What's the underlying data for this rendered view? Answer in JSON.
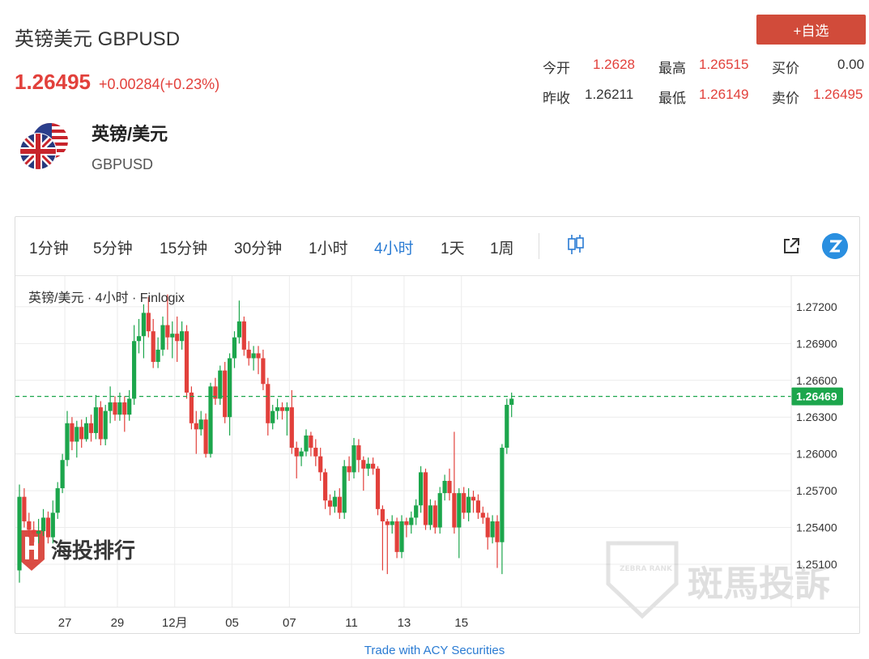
{
  "header": {
    "title": "英镑美元 GBPUSD",
    "price": "1.26495",
    "change": "+0.00284(+0.23%)",
    "add_button": "+自选"
  },
  "quotes": [
    {
      "label": "今开",
      "value": "1.2628"
    },
    {
      "label": "最高",
      "value": "1.26515"
    },
    {
      "label": "买价",
      "value": "0.00"
    },
    {
      "label": "昨收",
      "value": "1.26211"
    },
    {
      "label": "最低",
      "value": "1.26149"
    },
    {
      "label": "卖价",
      "value": "1.26495"
    }
  ],
  "instrument": {
    "name_cn": "英镑/美元",
    "code": "GBPUSD"
  },
  "toolbar": {
    "timeframes": [
      "1分钟",
      "5分钟",
      "15分钟",
      "30分钟",
      "1小时",
      "4小时",
      "1天",
      "1周"
    ],
    "active": "4小时"
  },
  "footer": {
    "link": "Trade with ACY Securities"
  },
  "watermark": {
    "left": "海投排行",
    "right": "斑馬投訴",
    "badge": "ZEBRA RANK"
  },
  "colors": {
    "up": "#1ca64c",
    "down": "#e2403b",
    "accent": "#2a7bd3",
    "button": "#d14b3a"
  },
  "chart_data": {
    "type": "candlestick",
    "legend": "英镑/美元 · 4小时 · Finlogix",
    "y_ticks": [
      1.272,
      1.269,
      1.266,
      1.263,
      1.26,
      1.257,
      1.254,
      1.251
    ],
    "y_tick_labels": [
      "1.27200",
      "1.26900",
      "1.26600",
      "1.26300",
      "1.26000",
      "1.25700",
      "1.25400",
      "1.25100"
    ],
    "y_range": [
      1.2475,
      1.2745
    ],
    "x_ticks": [
      {
        "label": "27",
        "x": 9.5
      },
      {
        "label": "29",
        "x": 20.5
      },
      {
        "label": "12月",
        "x": 32.5
      },
      {
        "label": "05",
        "x": 44.5
      },
      {
        "label": "07",
        "x": 56.5
      },
      {
        "label": "11",
        "x": 69.5
      },
      {
        "label": "13",
        "x": 80.5
      },
      {
        "label": "15",
        "x": 92.5
      }
    ],
    "current_price": 1.26469,
    "current_price_label": "1.26469",
    "candles": [
      [
        1.2505,
        1.2565,
        1.2495,
        1.2575
      ],
      [
        1.2565,
        1.2545,
        1.254,
        1.2572
      ],
      [
        1.2545,
        1.2538,
        1.2532,
        1.2552
      ],
      [
        1.2538,
        1.2535,
        1.2528,
        1.2545
      ],
      [
        1.2535,
        1.2537,
        1.2527,
        1.2547
      ],
      [
        1.2537,
        1.2548,
        1.2533,
        1.2555
      ],
      [
        1.2548,
        1.2532,
        1.2527,
        1.2553
      ],
      [
        1.2532,
        1.2552,
        1.2527,
        1.2562
      ],
      [
        1.2552,
        1.2572,
        1.2547,
        1.2577
      ],
      [
        1.2572,
        1.2595,
        1.2568,
        1.26
      ],
      [
        1.2595,
        1.2625,
        1.259,
        1.2635
      ],
      [
        1.2625,
        1.261,
        1.2603,
        1.263
      ],
      [
        1.261,
        1.2622,
        1.2597,
        1.2627
      ],
      [
        1.2622,
        1.2612,
        1.2605,
        1.2628
      ],
      [
        1.2612,
        1.2625,
        1.261,
        1.263
      ],
      [
        1.2625,
        1.2617,
        1.261,
        1.2632
      ],
      [
        1.2617,
        1.2638,
        1.2612,
        1.2648
      ],
      [
        1.2638,
        1.2612,
        1.2607,
        1.2643
      ],
      [
        1.2612,
        1.2635,
        1.2607,
        1.264
      ],
      [
        1.2635,
        1.2642,
        1.2625,
        1.2655
      ],
      [
        1.2642,
        1.2632,
        1.2627,
        1.2647
      ],
      [
        1.2632,
        1.2642,
        1.2627,
        1.265
      ],
      [
        1.2642,
        1.2632,
        1.2618,
        1.2647
      ],
      [
        1.2632,
        1.2645,
        1.2627,
        1.2652
      ],
      [
        1.2645,
        1.2692,
        1.264,
        1.2705
      ],
      [
        1.2692,
        1.2696,
        1.2682,
        1.271
      ],
      [
        1.2696,
        1.2715,
        1.2678,
        1.2722
      ],
      [
        1.2715,
        1.27,
        1.2695,
        1.2728
      ],
      [
        1.27,
        1.2675,
        1.267,
        1.271
      ],
      [
        1.2675,
        1.2685,
        1.267,
        1.2695
      ],
      [
        1.2685,
        1.2705,
        1.268,
        1.2712
      ],
      [
        1.2705,
        1.2695,
        1.2685,
        1.273
      ],
      [
        1.2695,
        1.2698,
        1.2678,
        1.2708
      ],
      [
        1.2698,
        1.2692,
        1.2675,
        1.2712
      ],
      [
        1.2692,
        1.27,
        1.2685,
        1.2708
      ],
      [
        1.27,
        1.265,
        1.2645,
        1.2705
      ],
      [
        1.265,
        1.2625,
        1.262,
        1.2655
      ],
      [
        1.2625,
        1.262,
        1.26,
        1.2635
      ],
      [
        1.262,
        1.2628,
        1.2615,
        1.2635
      ],
      [
        1.2628,
        1.26,
        1.2597,
        1.2633
      ],
      [
        1.26,
        1.2655,
        1.2597,
        1.2658
      ],
      [
        1.2655,
        1.2645,
        1.264,
        1.2662
      ],
      [
        1.2645,
        1.2668,
        1.264,
        1.2672
      ],
      [
        1.2668,
        1.263,
        1.2625,
        1.2675
      ],
      [
        1.263,
        1.2678,
        1.2615,
        1.2682
      ],
      [
        1.2678,
        1.2695,
        1.267,
        1.27
      ],
      [
        1.2695,
        1.2708,
        1.269,
        1.2725
      ],
      [
        1.2708,
        1.2685,
        1.268,
        1.2712
      ],
      [
        1.2685,
        1.2678,
        1.2672,
        1.2692
      ],
      [
        1.2678,
        1.2682,
        1.2668,
        1.2688
      ],
      [
        1.2682,
        1.2678,
        1.2665,
        1.2688
      ],
      [
        1.2678,
        1.2657,
        1.2652,
        1.2685
      ],
      [
        1.2657,
        1.2625,
        1.2615,
        1.2662
      ],
      [
        1.2625,
        1.2635,
        1.262,
        1.264
      ],
      [
        1.2635,
        1.2638,
        1.2628,
        1.2645
      ],
      [
        1.2638,
        1.2635,
        1.2628,
        1.2642
      ],
      [
        1.2635,
        1.2638,
        1.2615,
        1.2642
      ],
      [
        1.2638,
        1.2605,
        1.26,
        1.2652
      ],
      [
        1.2605,
        1.2598,
        1.258,
        1.261
      ],
      [
        1.2598,
        1.2602,
        1.259,
        1.2605
      ],
      [
        1.2602,
        1.2615,
        1.2598,
        1.262
      ],
      [
        1.2615,
        1.2605,
        1.2598,
        1.2618
      ],
      [
        1.2605,
        1.2598,
        1.259,
        1.2612
      ],
      [
        1.2598,
        1.2585,
        1.2578,
        1.2605
      ],
      [
        1.2585,
        1.2562,
        1.2555,
        1.2588
      ],
      [
        1.2562,
        1.2557,
        1.255,
        1.2567
      ],
      [
        1.2557,
        1.2565,
        1.2552,
        1.257
      ],
      [
        1.2565,
        1.2552,
        1.2547,
        1.2572
      ],
      [
        1.2552,
        1.259,
        1.2547,
        1.2595
      ],
      [
        1.259,
        1.2585,
        1.2578,
        1.2598
      ],
      [
        1.2585,
        1.2607,
        1.258,
        1.2613
      ],
      [
        1.2607,
        1.2595,
        1.2585,
        1.2612
      ],
      [
        1.2595,
        1.2588,
        1.257,
        1.2598
      ],
      [
        1.2588,
        1.2592,
        1.2582,
        1.2597
      ],
      [
        1.2592,
        1.2588,
        1.2583,
        1.2597
      ],
      [
        1.2588,
        1.2555,
        1.255,
        1.259
      ],
      [
        1.2555,
        1.2545,
        1.2505,
        1.2558
      ],
      [
        1.2545,
        1.2542,
        1.2502,
        1.2547
      ],
      [
        1.2542,
        1.2545,
        1.2535,
        1.255
      ],
      [
        1.2545,
        1.252,
        1.2515,
        1.2548
      ],
      [
        1.252,
        1.2545,
        1.2515,
        1.255
      ],
      [
        1.2545,
        1.2542,
        1.2532,
        1.2548
      ],
      [
        1.2542,
        1.2548,
        1.2535,
        1.2553
      ],
      [
        1.2548,
        1.2558,
        1.2542,
        1.2563
      ],
      [
        1.2558,
        1.2585,
        1.2552,
        1.259
      ],
      [
        1.2585,
        1.2542,
        1.2538,
        1.2588
      ],
      [
        1.2542,
        1.2558,
        1.2538,
        1.2563
      ],
      [
        1.2558,
        1.254,
        1.2535,
        1.2562
      ],
      [
        1.254,
        1.2568,
        1.2535,
        1.2573
      ],
      [
        1.2568,
        1.2578,
        1.2562,
        1.2583
      ],
      [
        1.2578,
        1.2568,
        1.2562,
        1.2588
      ],
      [
        1.2568,
        1.254,
        1.2535,
        1.2618
      ],
      [
        1.254,
        1.2568,
        1.2515,
        1.2572
      ],
      [
        1.2568,
        1.2552,
        1.2547,
        1.2573
      ],
      [
        1.2552,
        1.2565,
        1.2545,
        1.2572
      ],
      [
        1.2565,
        1.2562,
        1.2552,
        1.257
      ],
      [
        1.2562,
        1.2552,
        1.2547,
        1.2567
      ],
      [
        1.2552,
        1.2548,
        1.2543,
        1.2557
      ],
      [
        1.2548,
        1.2532,
        1.2522,
        1.2552
      ],
      [
        1.2532,
        1.2545,
        1.2527,
        1.255
      ],
      [
        1.2545,
        1.2528,
        1.2507,
        1.255
      ],
      [
        1.2528,
        1.2605,
        1.2502,
        1.2608
      ],
      [
        1.2605,
        1.264,
        1.26,
        1.2645
      ],
      [
        1.264,
        1.2645,
        1.263,
        1.265
      ]
    ]
  }
}
